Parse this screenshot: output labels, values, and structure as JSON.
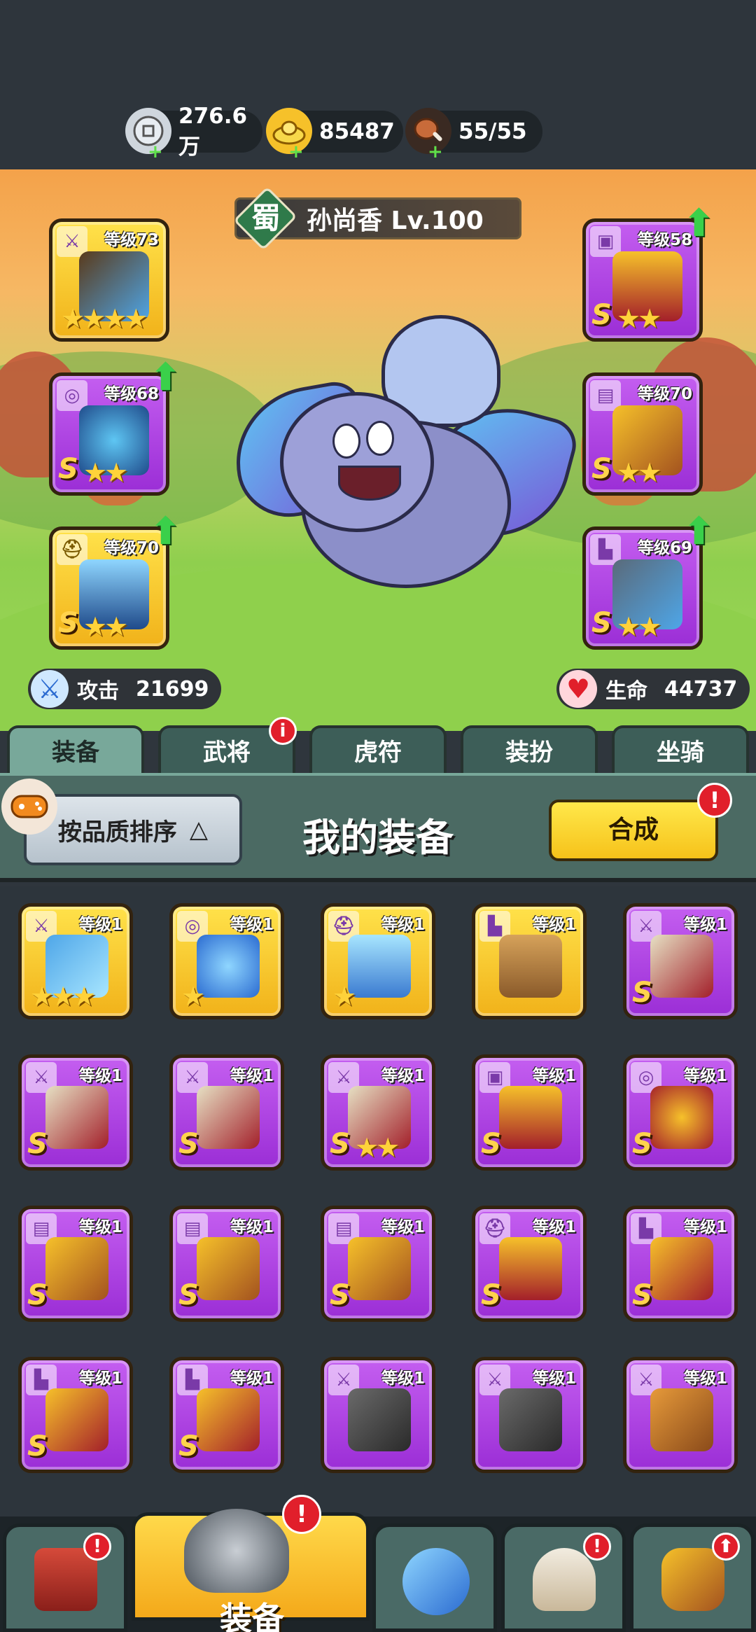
{
  "resources": {
    "silver": "276.6万",
    "gold": "85487",
    "stamina": "55/55",
    "plus": "+"
  },
  "hero": {
    "faction": "蜀",
    "name": "孙尚香 Lv.100",
    "attack_label": "攻击",
    "attack_value": "21699",
    "hp_label": "生命",
    "hp_value": "44737"
  },
  "slots": {
    "weapon": {
      "level": "等级73",
      "rarity": "",
      "stars": "★★★★"
    },
    "necklace": {
      "level": "等级68",
      "rarity": "S",
      "stars": "★★"
    },
    "helmet": {
      "level": "等级70",
      "rarity": "S",
      "stars": "★★"
    },
    "armor": {
      "level": "等级58",
      "rarity": "S",
      "stars": "★★"
    },
    "belt": {
      "level": "等级70",
      "rarity": "S",
      "stars": "★★"
    },
    "boots": {
      "level": "等级69",
      "rarity": "S",
      "stars": "★★"
    }
  },
  "tabs": [
    "装备",
    "武将",
    "虎符",
    "装扮",
    "坐骑"
  ],
  "badge_i": "i",
  "badge_ex": "!",
  "panel": {
    "sort_label": "按品质排序",
    "sort_arrow": "△",
    "title": "我的装备",
    "merge_label": "合成"
  },
  "inventory": [
    {
      "level": "等级1",
      "rarity": "",
      "stars": "★★★"
    },
    {
      "level": "等级1",
      "rarity": "",
      "stars": "★"
    },
    {
      "level": "等级1",
      "rarity": "",
      "stars": "★"
    },
    {
      "level": "等级1",
      "rarity": "",
      "stars": ""
    },
    {
      "level": "等级1",
      "rarity": "S",
      "stars": ""
    },
    {
      "level": "等级1",
      "rarity": "S",
      "stars": ""
    },
    {
      "level": "等级1",
      "rarity": "S",
      "stars": ""
    },
    {
      "level": "等级1",
      "rarity": "S",
      "stars": "★★"
    },
    {
      "level": "等级1",
      "rarity": "S",
      "stars": ""
    },
    {
      "level": "等级1",
      "rarity": "S",
      "stars": ""
    },
    {
      "level": "等级1",
      "rarity": "S",
      "stars": ""
    },
    {
      "level": "等级1",
      "rarity": "S",
      "stars": ""
    },
    {
      "level": "等级1",
      "rarity": "S",
      "stars": ""
    },
    {
      "level": "等级1",
      "rarity": "S",
      "stars": ""
    },
    {
      "level": "等级1",
      "rarity": "S",
      "stars": ""
    },
    {
      "level": "等级1",
      "rarity": "S",
      "stars": ""
    },
    {
      "level": "等级1",
      "rarity": "S",
      "stars": ""
    },
    {
      "level": "等级1",
      "rarity": "",
      "stars": ""
    },
    {
      "level": "等级1",
      "rarity": "",
      "stars": ""
    },
    {
      "level": "等级1",
      "rarity": "",
      "stars": ""
    }
  ],
  "nav": {
    "active_label": "装备"
  },
  "colors": {
    "gold_card": "#f1b21a",
    "purple_card": "#9b2ed6",
    "tab_active": "#78a89a",
    "badge": "#e11f2b"
  }
}
